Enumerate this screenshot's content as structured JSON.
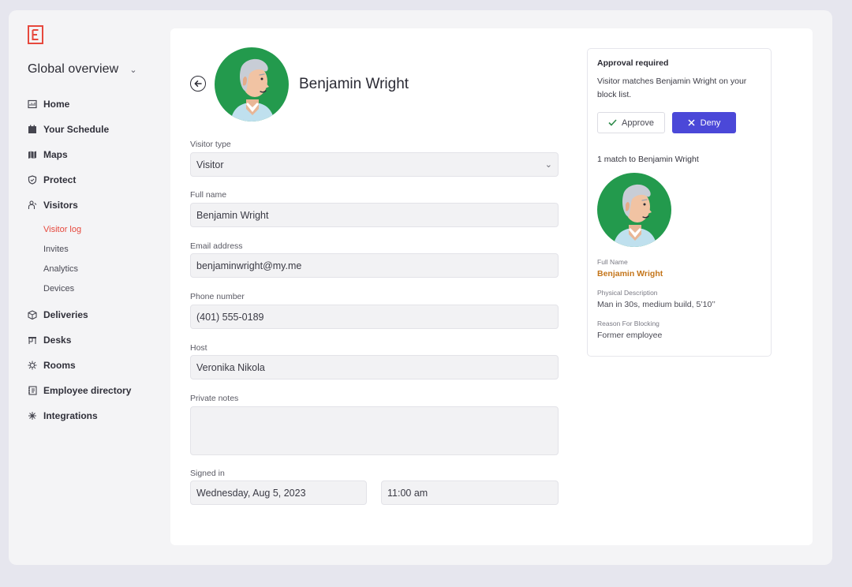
{
  "app": {
    "org_name": "Global overview"
  },
  "sidebar": {
    "items": [
      {
        "label": "Home",
        "icon": "home-icon"
      },
      {
        "label": "Your Schedule",
        "icon": "calendar-icon"
      },
      {
        "label": "Maps",
        "icon": "map-icon"
      },
      {
        "label": "Protect",
        "icon": "shield-icon"
      },
      {
        "label": "Visitors",
        "icon": "visitor-icon"
      },
      {
        "label": "Deliveries",
        "icon": "package-icon"
      },
      {
        "label": "Desks",
        "icon": "desk-icon"
      },
      {
        "label": "Rooms",
        "icon": "rooms-icon"
      },
      {
        "label": "Employee directory",
        "icon": "directory-icon"
      },
      {
        "label": "Integrations",
        "icon": "integrations-icon"
      }
    ],
    "visitors_sub": [
      {
        "label": "Visitor log",
        "active": true
      },
      {
        "label": "Invites"
      },
      {
        "label": "Analytics"
      },
      {
        "label": "Devices"
      }
    ]
  },
  "visitor": {
    "name": "Benjamin Wright",
    "visitor_type_label": "Visitor type",
    "visitor_type": "Visitor",
    "full_name_label": "Full name",
    "full_name": "Benjamin Wright",
    "email_label": "Email address",
    "email": "benjaminwright@my.me",
    "phone_label": "Phone number",
    "phone": "(401) 555-0189",
    "host_label": "Host",
    "host": "Veronika Nikola",
    "notes_label": "Private notes",
    "notes": "",
    "signed_in_label": "Signed in",
    "signed_in_date": "Wednesday, Aug 5, 2023",
    "signed_in_time": "11:00 am"
  },
  "approval": {
    "title": "Approval required",
    "message": "Visitor matches Benjamin Wright on your block list.",
    "approve_label": "Approve",
    "deny_label": "Deny",
    "match_count": "1 match to Benjamin Wright",
    "full_name_label": "Full Name",
    "full_name": "Benjamin Wright",
    "physical_label": "Physical Description",
    "physical": "Man in 30s, medium build, 5’10’’",
    "reason_label": "Reason For Blocking",
    "reason": "Former employee"
  },
  "colors": {
    "accent": "#e6483d",
    "deny_button": "#4b48d8",
    "avatar_bg": "#239a4d",
    "match_name": "#c4751a"
  }
}
